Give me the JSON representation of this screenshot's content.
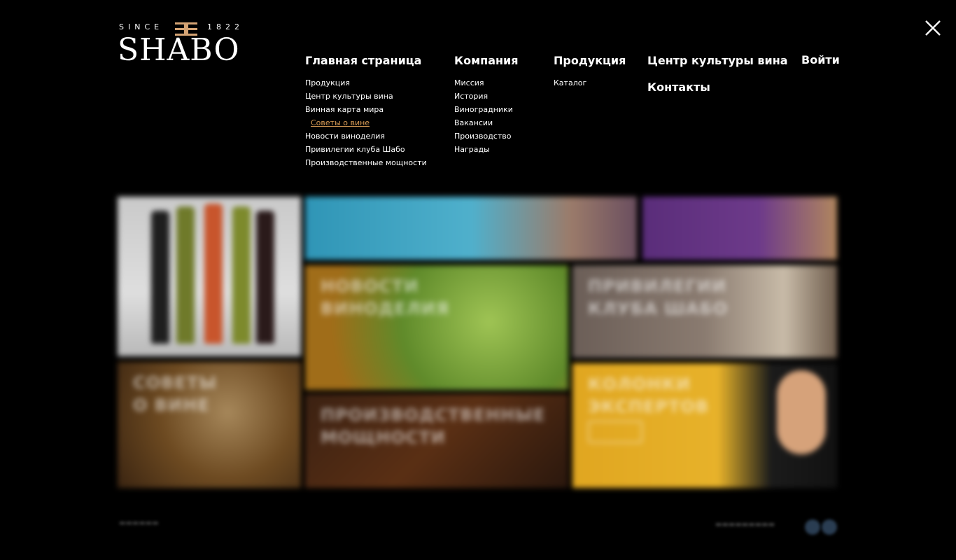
{
  "logo": {
    "since": "SINCE",
    "year": "1822",
    "brand": "SHABO"
  },
  "nav": {
    "columns": [
      {
        "heading": "Главная страница",
        "items": [
          {
            "label": "Продукция"
          },
          {
            "label": "Центр культуры вина"
          },
          {
            "label": "Винная карта мира"
          },
          {
            "label": "Советы о вине",
            "active": true
          },
          {
            "label": "Новости виноделия"
          },
          {
            "label": "Привилегии клуба Шабо"
          },
          {
            "label": "Производственные мощности"
          }
        ]
      },
      {
        "heading": "Компания",
        "items": [
          {
            "label": "Миссия"
          },
          {
            "label": "История"
          },
          {
            "label": "Виноградники"
          },
          {
            "label": "Вакансии"
          },
          {
            "label": "Производство"
          },
          {
            "label": "Награды"
          }
        ]
      },
      {
        "heading": "Продукция",
        "items": [
          {
            "label": "Каталог"
          }
        ]
      }
    ],
    "culture": "Центр культуры вина",
    "contacts": "Контакты",
    "login": "Войти"
  },
  "tiles": {
    "news": "Новости виноделия",
    "privileges": "Привилегии клуба Шабо",
    "tips": "Советы о вине",
    "production": "Производственные мощности",
    "experts": "Колонки экспертов"
  },
  "colors": {
    "background": "#000000",
    "accent": "#d69a55",
    "text": "#ffffff"
  },
  "icons": {
    "close": "close-icon"
  }
}
